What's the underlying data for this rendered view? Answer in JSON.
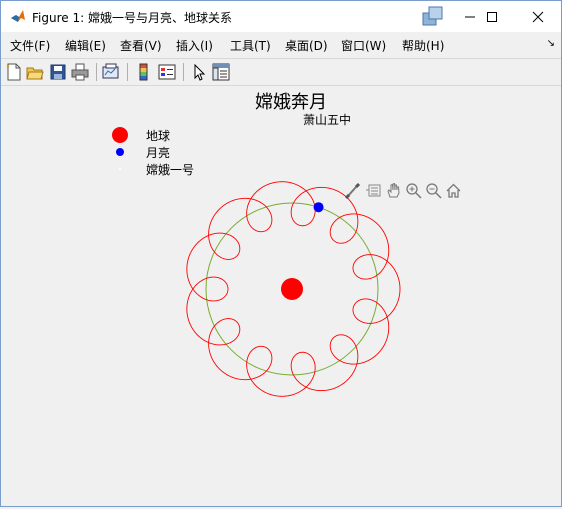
{
  "window": {
    "title": "Figure 1: 嫦娥一号与月亮、地球关系"
  },
  "menu": {
    "items": [
      {
        "label": "文件(F)"
      },
      {
        "label": "编辑(E)"
      },
      {
        "label": "查看(V)"
      },
      {
        "label": "插入(I)"
      },
      {
        "label": "工具(T)"
      },
      {
        "label": "桌面(D)"
      },
      {
        "label": "窗口(W)"
      },
      {
        "label": "帮助(H)"
      }
    ],
    "more_glyph": "↘"
  },
  "toolbar": {
    "icons": [
      "new-figure-icon",
      "open-file-icon",
      "save-icon",
      "print-icon",
      "link-plot-icon",
      "insert-colorbar-icon",
      "insert-legend-icon",
      "edit-plot-icon",
      "property-inspector-icon"
    ]
  },
  "axes_toolbar": {
    "icons": [
      "brush-icon",
      "datatips-icon",
      "pan-icon",
      "zoom-in-icon",
      "zoom-out-icon",
      "home-icon"
    ]
  },
  "plot": {
    "title": "嫦娥奔月",
    "subtitle": "萧山五中",
    "legend": [
      {
        "label": "地球",
        "color": "#ff0000",
        "marker": "large-dot"
      },
      {
        "label": "月亮",
        "color": "#0000ff",
        "marker": "dot"
      },
      {
        "label": "嫦娥一号",
        "color": "#ffffff",
        "marker": "point"
      }
    ],
    "colors": {
      "earth": "#ff0000",
      "moon": "#0000ff",
      "moon_orbit": "#77ac30",
      "spacecraft_path": "#ff0000",
      "background": "#f0f0f0"
    },
    "loops": 12,
    "moon_position_degrees": 72
  }
}
